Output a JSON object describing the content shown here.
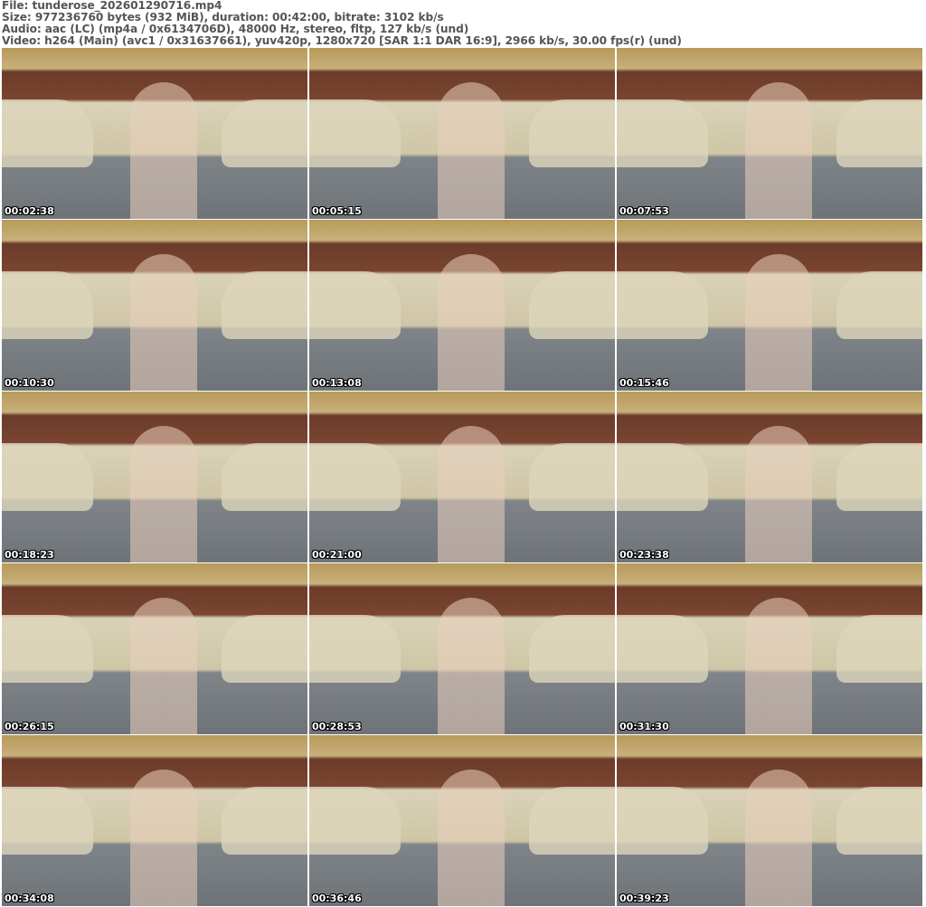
{
  "header": {
    "file": "File: tunderose_202601290716.mp4",
    "size": "Size: 977236760 bytes (932 MiB), duration: 00:42:00, bitrate: 3102 kb/s",
    "audio": "Audio: aac (LC) (mp4a / 0x6134706D), 48000 Hz, stereo, fltp, 127 kb/s (und)",
    "video": "Video: h264 (Main) (avc1 / 0x31637661), yuv420p, 1280x720 [SAR 1:1 DAR 16:9], 2966 kb/s, 30.00 fps(r) (und)"
  },
  "thumbnails": [
    {
      "timestamp": "00:02:38"
    },
    {
      "timestamp": "00:05:15"
    },
    {
      "timestamp": "00:07:53"
    },
    {
      "timestamp": "00:10:30"
    },
    {
      "timestamp": "00:13:08"
    },
    {
      "timestamp": "00:15:46"
    },
    {
      "timestamp": "00:18:23"
    },
    {
      "timestamp": "00:21:00"
    },
    {
      "timestamp": "00:23:38"
    },
    {
      "timestamp": "00:26:15"
    },
    {
      "timestamp": "00:28:53"
    },
    {
      "timestamp": "00:31:30"
    },
    {
      "timestamp": "00:34:08"
    },
    {
      "timestamp": "00:36:46"
    },
    {
      "timestamp": "00:39:23"
    }
  ]
}
